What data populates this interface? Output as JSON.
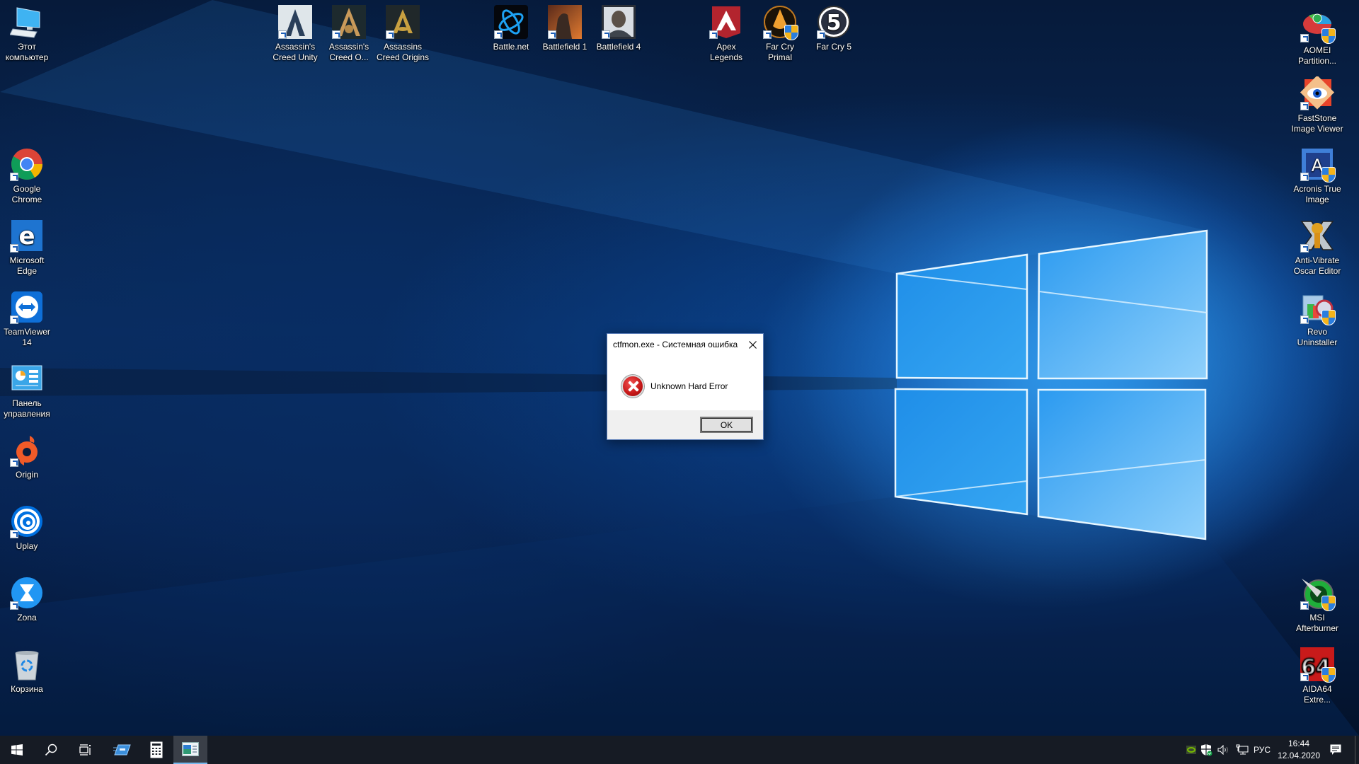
{
  "desktop": {
    "left_column": [
      {
        "id": "this-pc",
        "label": "Этот компьютер",
        "shortcut": false
      },
      {
        "id": "google-chrome",
        "label": "Google Chrome",
        "shortcut": true
      },
      {
        "id": "microsoft-edge",
        "label": "Microsoft Edge",
        "shortcut": true
      },
      {
        "id": "teamviewer",
        "label": "TeamViewer 14",
        "shortcut": true
      },
      {
        "id": "control-panel",
        "label": "Панель управления",
        "shortcut": false
      },
      {
        "id": "origin",
        "label": "Origin",
        "shortcut": true
      },
      {
        "id": "uplay",
        "label": "Uplay",
        "shortcut": true
      },
      {
        "id": "zona",
        "label": "Zona",
        "shortcut": true
      },
      {
        "id": "recycle-bin",
        "label": "Корзина",
        "shortcut": false
      }
    ],
    "top_row": [
      {
        "id": "assassins-creed-unity",
        "label": "Assassin's Creed Unity"
      },
      {
        "id": "assassins-creed-odyssey",
        "label": "Assassin's Creed O..."
      },
      {
        "id": "assassins-creed-origins",
        "label": "Assassins Creed Origins"
      },
      {
        "id": "battle-net",
        "label": "Battle.net"
      },
      {
        "id": "battlefield-1",
        "label": "Battlefield 1"
      },
      {
        "id": "battlefield-4",
        "label": "Battlefield 4"
      },
      {
        "id": "apex-legends",
        "label": "Apex Legends"
      },
      {
        "id": "far-cry-primal",
        "label": "Far Cry Primal"
      },
      {
        "id": "far-cry-5",
        "label": "Far Cry 5"
      }
    ],
    "right_column": [
      {
        "id": "aomei-partition",
        "label": "AOMEI Partition..."
      },
      {
        "id": "faststone-image-viewer",
        "label": "FastStone Image Viewer"
      },
      {
        "id": "acronis-true-image",
        "label": "Acronis True Image"
      },
      {
        "id": "anti-vibrate-oscar-editor",
        "label": "Anti-Vibrate Oscar Editor"
      },
      {
        "id": "revo-uninstaller",
        "label": "Revo Uninstaller"
      },
      {
        "id": "msi-afterburner",
        "label": "MSI Afterburner"
      },
      {
        "id": "aida64",
        "label": "AIDA64 Extre..."
      }
    ]
  },
  "dialog": {
    "title": "ctfmon.exe - Системная ошибка",
    "message": "Unknown Hard Error",
    "ok_label": "OK",
    "close_icon": "close-icon",
    "icon": "error-icon"
  },
  "taskbar": {
    "start": "windows-start-icon",
    "search": "search-icon",
    "task_view": "task-view-icon",
    "pinned": [
      {
        "id": "remote-desktop",
        "icon": "remote-desktop-icon"
      },
      {
        "id": "calculator",
        "icon": "calculator-icon"
      },
      {
        "id": "control-panel-window",
        "icon": "control-panel-icon",
        "active": true
      }
    ],
    "tray": {
      "nvidia": "nvidia-icon",
      "security": "windows-security-icon",
      "volume": "volume-icon",
      "network": "network-icon",
      "language": "РУС",
      "time": "16:44",
      "date": "12.04.2020",
      "notifications": "action-center-icon"
    }
  },
  "colors": {
    "accent": "#76b9ed",
    "taskbar_bg": "#161b24",
    "dialog_footer": "#f0f0f0",
    "error_red": "#c41616"
  }
}
